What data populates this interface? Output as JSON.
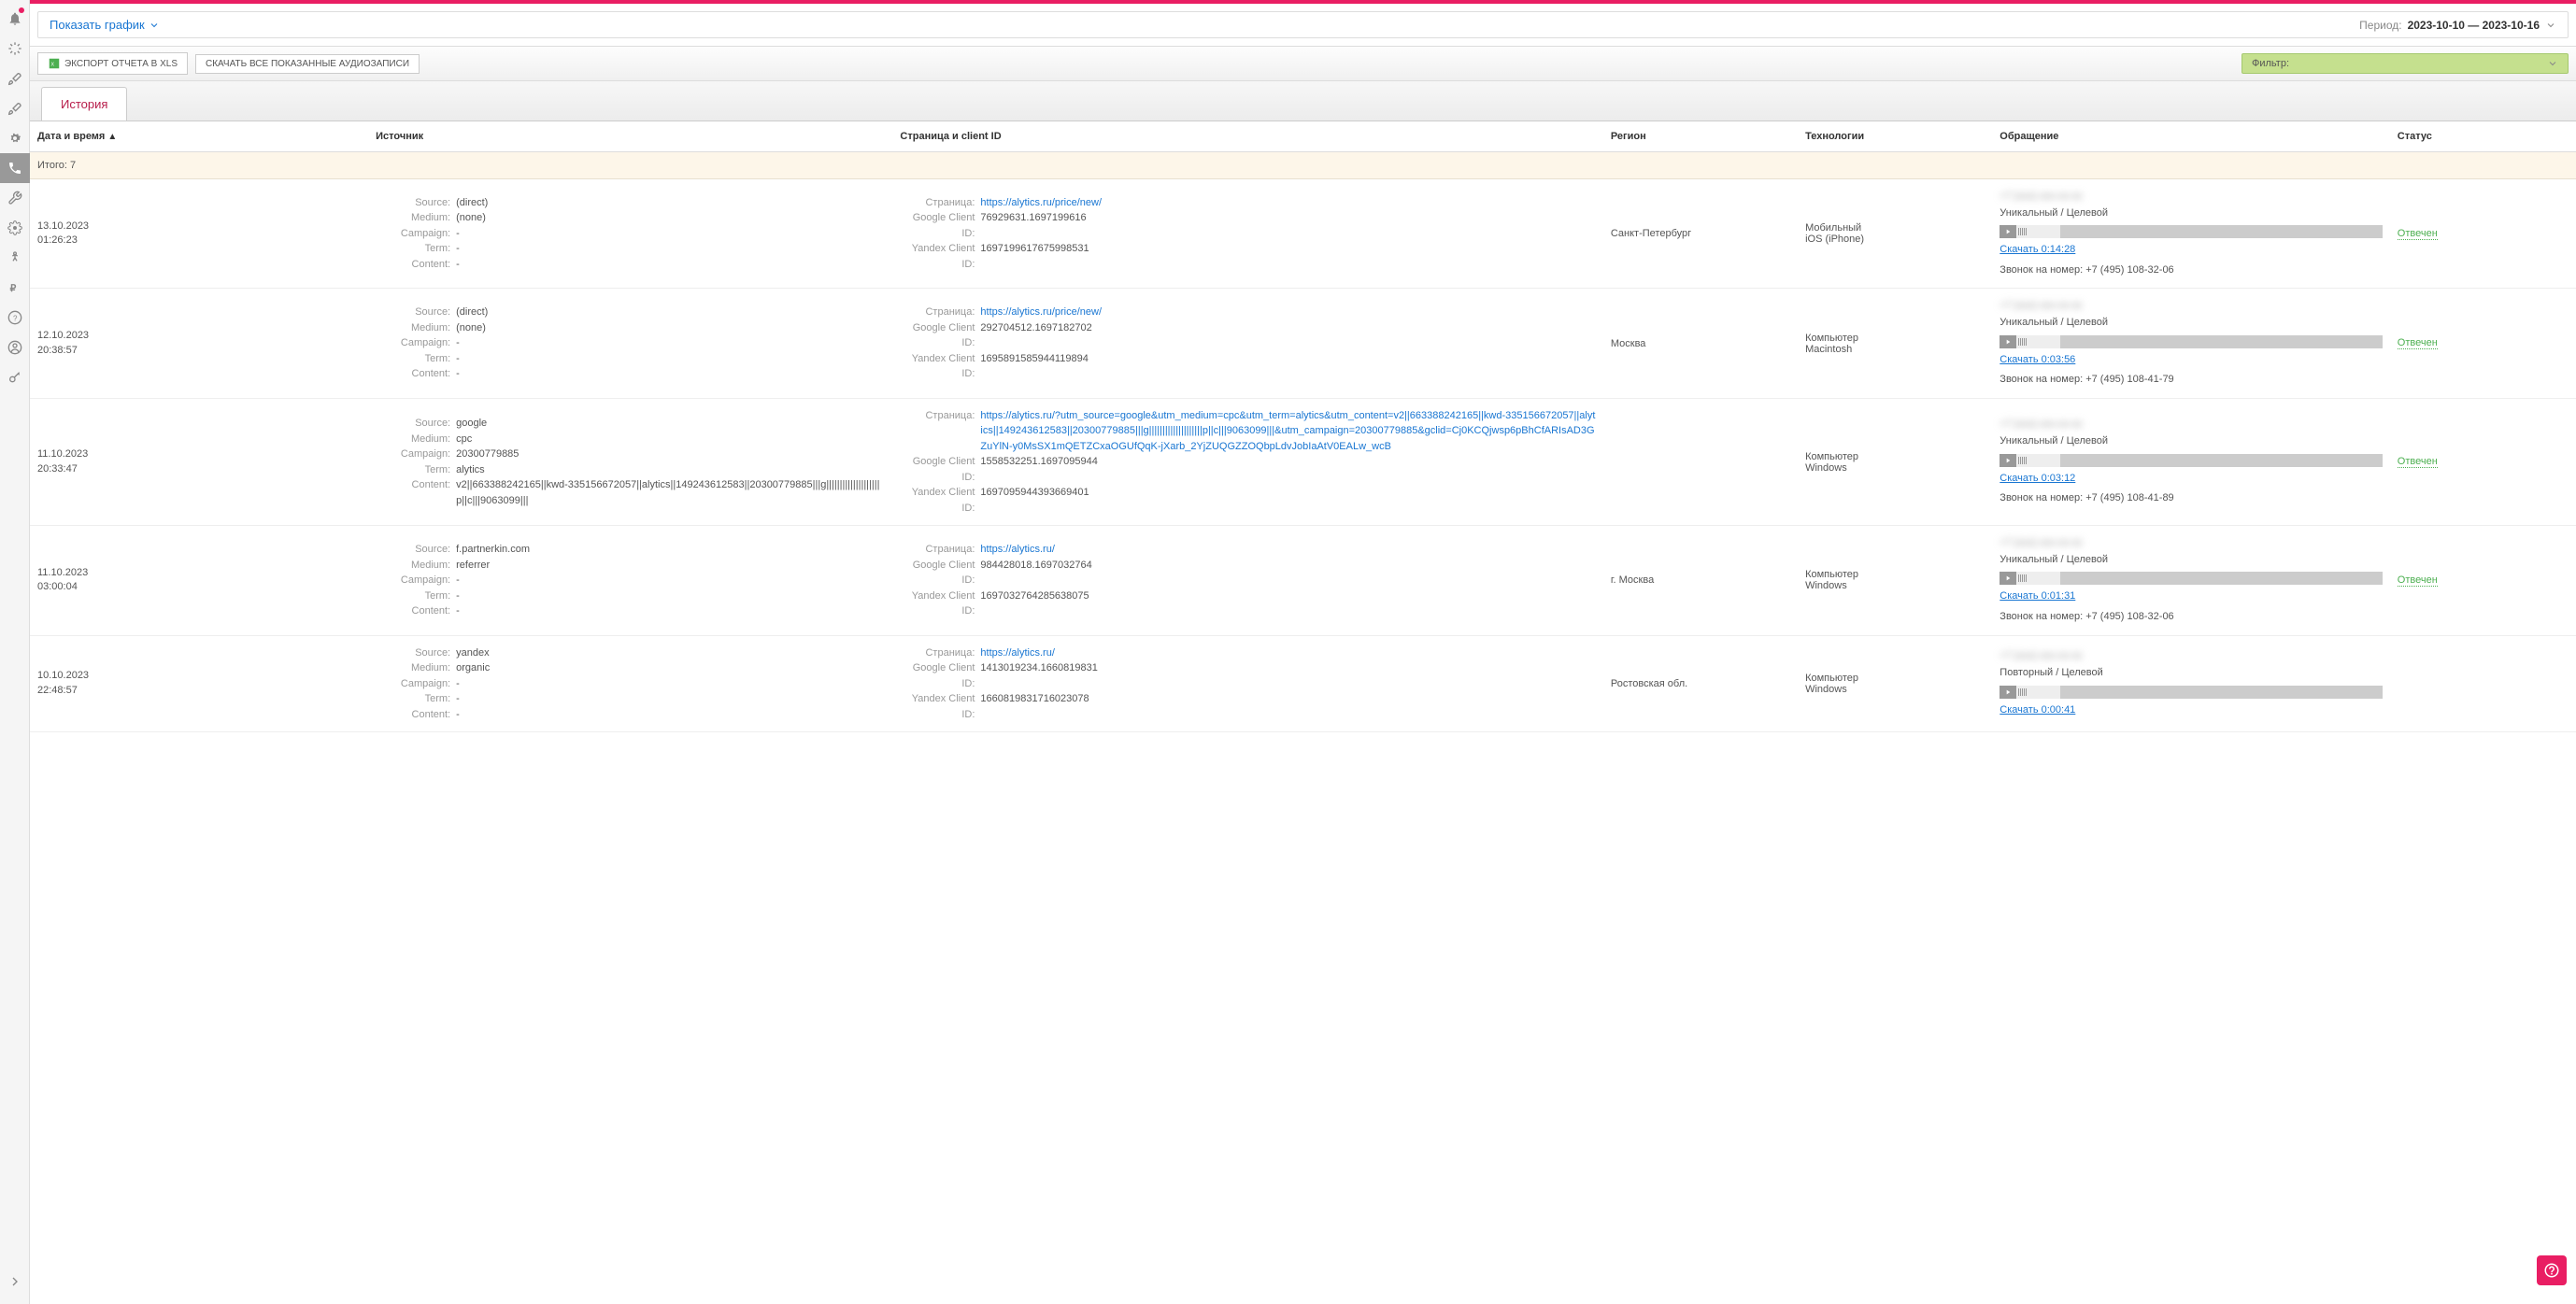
{
  "chart_toggle": "Показать график",
  "period_label": "Период:",
  "period_value": "2023-10-10 — 2023-10-16",
  "export_xls": "ЭКСПОРТ ОТЧЕТА В XLS",
  "download_audio": "СКАЧАТЬ ВСЕ ПОКАЗАННЫЕ АУДИОЗАПИСИ",
  "filter_label": "Фильтр:",
  "tab_history": "История",
  "columns": {
    "date": "Дата и время",
    "source": "Источник",
    "page": "Страница и client ID",
    "region": "Регион",
    "tech": "Технологии",
    "call": "Обращение",
    "status": "Статус"
  },
  "total_label": "Итого: 7",
  "labels": {
    "source": "Source:",
    "medium": "Medium:",
    "campaign": "Campaign:",
    "term": "Term:",
    "content": "Content:",
    "page": "Страница:",
    "google_id": "Google Client ID:",
    "yandex_id": "Yandex Client ID:",
    "download": "Скачать",
    "call_to": "Звонок на номер:",
    "unique_target": "Уникальный / Целевой",
    "repeat_target": "Повторный / Целевой",
    "answered": "Отвечен"
  },
  "rows": [
    {
      "date": "13.10.2023",
      "time": "01:26:23",
      "source": "(direct)",
      "medium": "(none)",
      "campaign": "-",
      "term": "-",
      "content": "-",
      "page": "https://alytics.ru/price/new/",
      "google_id": "76929631.1697199616",
      "yandex_id": "1697199617675998531",
      "region": "Санкт-Петербург",
      "tech1": "Мобильный",
      "tech2": "iOS (iPhone)",
      "call_type": "Уникальный / Целевой",
      "duration": "0:14:28",
      "number": "+7 (495) 108-32-06",
      "status": "Отвечен"
    },
    {
      "date": "12.10.2023",
      "time": "20:38:57",
      "source": "(direct)",
      "medium": "(none)",
      "campaign": "-",
      "term": "-",
      "content": "-",
      "page": "https://alytics.ru/price/new/",
      "google_id": "292704512.1697182702",
      "yandex_id": "1695891585944119894",
      "region": "Москва",
      "tech1": "Компьютер",
      "tech2": "Macintosh",
      "call_type": "Уникальный / Целевой",
      "duration": "0:03:56",
      "number": "+7 (495) 108-41-79",
      "status": "Отвечен"
    },
    {
      "date": "11.10.2023",
      "time": "20:33:47",
      "source": "google",
      "medium": "cpc",
      "campaign": "20300779885",
      "term": "alytics",
      "content": "v2||663388242165||kwd-335156672057||alytics||149243612583||20300779885|||g||||||||||||||||||||p||c|||9063099|||",
      "page": "https://alytics.ru/?utm_source=google&utm_medium=cpc&utm_term=alytics&utm_content=v2||663388242165||kwd-335156672057||alytics||149243612583||20300779885|||g||||||||||||||||||||p||c|||9063099|||&utm_campaign=20300779885&gclid=Cj0KCQjwsp6pBhCfARIsAD3GZuYlN-y0MsSX1mQETZCxaOGUfQqK-jXarb_2YjZUQGZZOQbpLdvJobIaAtV0EALw_wcB",
      "google_id": "1558532251.1697095944",
      "yandex_id": "1697095944393669401",
      "region": "",
      "tech1": "Компьютер",
      "tech2": "Windows",
      "call_type": "Уникальный / Целевой",
      "duration": "0:03:12",
      "number": "+7 (495) 108-41-89",
      "status": "Отвечен"
    },
    {
      "date": "11.10.2023",
      "time": "03:00:04",
      "source": "f.partnerkin.com",
      "medium": "referrer",
      "campaign": "-",
      "term": "-",
      "content": "-",
      "page": "https://alytics.ru/",
      "google_id": "984428018.1697032764",
      "yandex_id": "1697032764285638075",
      "region": "г. Москва",
      "tech1": "Компьютер",
      "tech2": "Windows",
      "call_type": "Уникальный / Целевой",
      "duration": "0:01:31",
      "number": "+7 (495) 108-32-06",
      "status": "Отвечен"
    },
    {
      "date": "10.10.2023",
      "time": "22:48:57",
      "source": "yandex",
      "medium": "organic",
      "campaign": "-",
      "term": "-",
      "content": "-",
      "page": "https://alytics.ru/",
      "google_id": "1413019234.1660819831",
      "yandex_id": "1660819831716023078",
      "region": "Ростовская обл.",
      "tech1": "Компьютер",
      "tech2": "Windows",
      "call_type": "Повторный / Целевой",
      "duration": "0:00:41",
      "number": "",
      "status": ""
    }
  ]
}
